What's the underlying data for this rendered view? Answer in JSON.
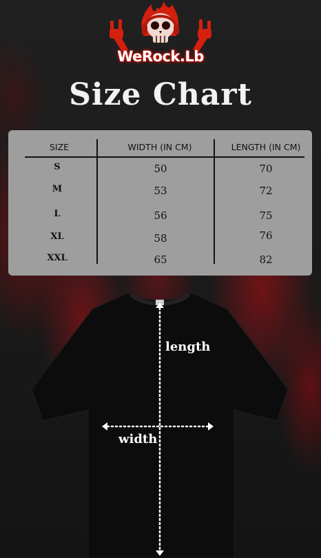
{
  "logo": {
    "text": "WeRock.Lb",
    "icon": "skull-horns-logo"
  },
  "title": "Size Chart",
  "table": {
    "headers": [
      "SIZE",
      "WIDTH (IN CM)",
      "LENGTH (IN CM)"
    ],
    "rows": [
      {
        "size": "S",
        "width": "50",
        "length": "70"
      },
      {
        "size": "M",
        "width": "53",
        "length": "72"
      },
      {
        "size": "L",
        "width": "56",
        "length": "75"
      },
      {
        "size": "XL",
        "width": "58",
        "length": "76"
      },
      {
        "size": "XXL",
        "width": "65",
        "length": "82"
      }
    ]
  },
  "diagram": {
    "length_label": "length",
    "width_label": "width",
    "shirt_color": "#0c0c0c"
  },
  "colors": {
    "panel": "#9e9e9e",
    "accent_red": "#c0140c",
    "background": "#1a1a1a"
  }
}
